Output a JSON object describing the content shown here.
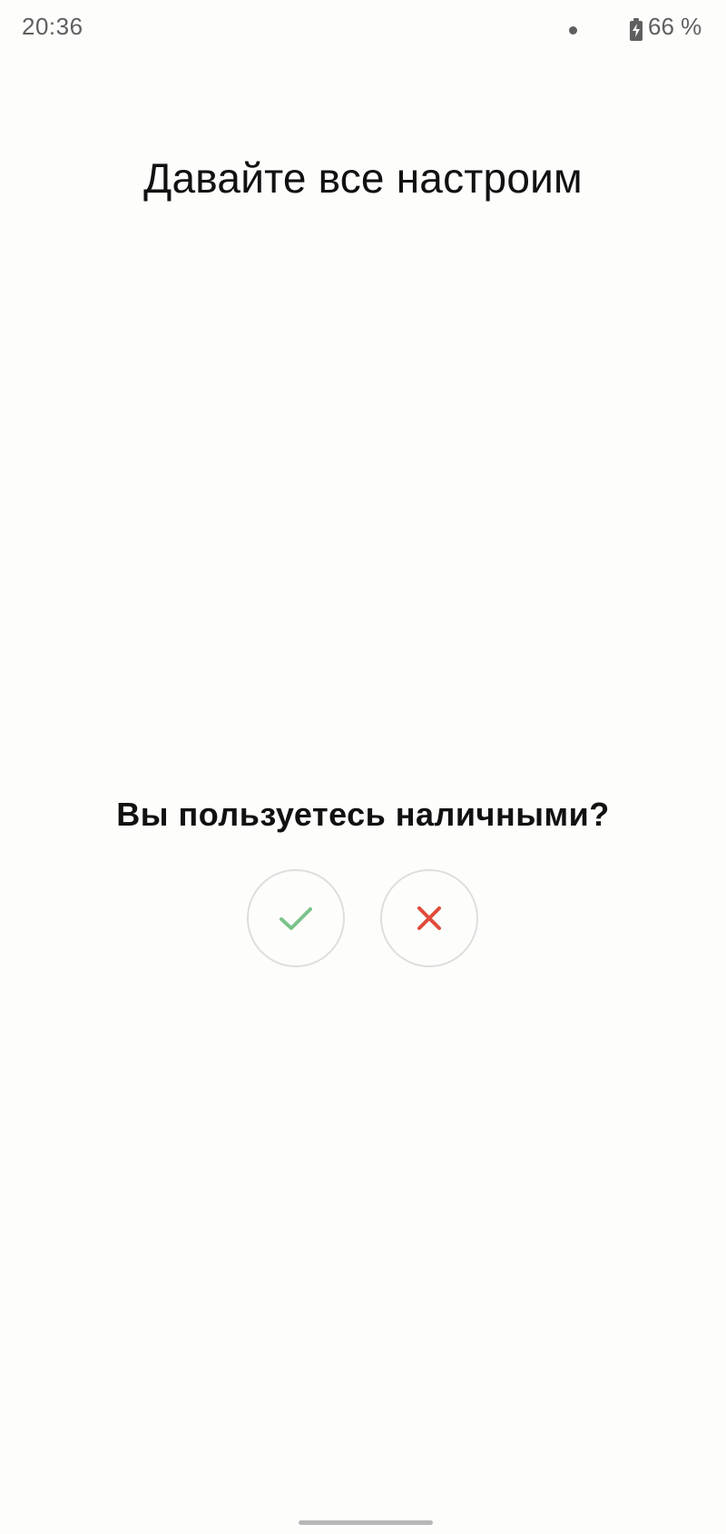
{
  "status_bar": {
    "time": "20:36",
    "battery_text": "66 %",
    "icons": {
      "notification": "dot-icon",
      "battery": "battery-charging-icon"
    }
  },
  "onboarding": {
    "title": "Давайте все настроим",
    "question": "Вы пользуетесь наличными?",
    "actions": {
      "yes": {
        "icon": "check-icon",
        "color": "#7cc38a"
      },
      "no": {
        "icon": "close-icon",
        "color": "#e14b3a"
      }
    }
  },
  "colors": {
    "background": "#fdfefc",
    "text_primary": "#111111",
    "status_text": "#5f5f5f",
    "button_border": "#dedede",
    "home_indicator": "#b7b7b7"
  }
}
